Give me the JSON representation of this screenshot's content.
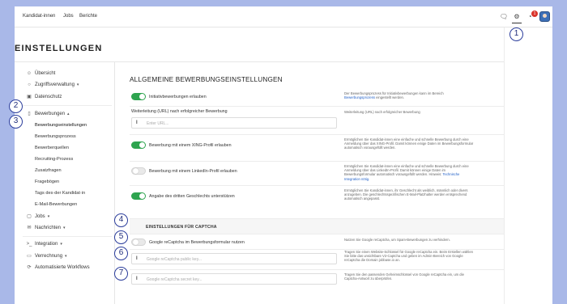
{
  "topnav": {
    "items": [
      "Kandidat-innen",
      "Jobs",
      "Berichte"
    ],
    "notification_count": "1"
  },
  "page_title": "EINSTELLUNGEN",
  "sidebar": {
    "overview": "Übersicht",
    "access": "Zugriffsverwaltung",
    "privacy": "Datenschutz",
    "applications": "Bewerbungen",
    "sub_items": [
      "Bewerbungseinstellungen",
      "Bewerbungsprozess",
      "Bewerberquellen",
      "Recruiting-Prozess",
      "Zusatzfragen",
      "Fragebögen",
      "Tags des·der Kandidat·in",
      "E-Mail-Bewerbungen"
    ],
    "jobs": "Jobs",
    "messages": "Nachrichten",
    "integration": "Integration",
    "billing": "Verrechnung",
    "workflows": "Automatisierte Workflows"
  },
  "main": {
    "title": "ALLGEMEINE BEWERBUNGSEINSTELLUNGEN",
    "options": [
      {
        "label": "Initiativbewerbungen erlauben",
        "on": true,
        "help": "Der Bewerbungsprozess für Initiativbewerbungen kann im Bereich",
        "help_link": "Bewerbungsprozess",
        "help_tail": "eingestellt werden."
      },
      {
        "label": "Bewerbung mit einem XING-Profil erlauben",
        "on": true,
        "help": "Ermöglichen Sie Kandidat-innen eine einfache und schnelle Bewerbung durch eine Anmeldung über das XING-Profil. Damit können einige Daten im Bewerbungsformular automatisch vorausgefüllt werden."
      },
      {
        "label": "Bewerbung mit einem LinkedIn-Profil erlauben",
        "on": false,
        "help": "Ermöglichen Sie Kandidat-innen eine einfache und schnelle Bewerbung durch eine Anmeldung über das LinkedIn-Profil. Damit können einige Daten im Bewerbungsformular automatisch vorausgefüllt werden. Hinweis:",
        "help_link": "Technische Integration nötig."
      },
      {
        "label": "Angabe des dritten Geschlechts unterstützen",
        "on": true,
        "help": "Ermöglichen Sie Kandidat-innen, ihr Geschlecht als weiblich, männlich oder divers anzugeben. Die geschlechtsspezifischen E-Mail-Platzhalter werden entsprechend automatisch angepasst."
      }
    ],
    "redirect": {
      "label": "Weiterleitung (URL) nach erfolgreicher Bewerbung",
      "placeholder": "Enter URL...",
      "help": "Weiterleitung (URL) nach erfolgreicher Bewerbung"
    },
    "captcha_section": "EINSTELLUNGEN FÜR CAPTCHA",
    "captcha": {
      "toggle_label": "Google reCaptcha im Bewerbungsformular nutzen",
      "toggle_on": false,
      "toggle_help": "Nutzen Sie Google reCaptcha, um Spam-Bewerbungen zu verhindern.",
      "public_key_placeholder": "Google reCaptcha public key...",
      "public_key_help": "Tragen Sie einen Website-Schlüssel für Google reCaptcha ein. Beim Erstellen wählen Sie bitte das unsichtbare V2-Captcha und geben im Admin-Bereich von Google reCaptcha die Domain jobbase.io an.",
      "secret_key_placeholder": "Google reCaptcha secret key...",
      "secret_key_help": "Tragen Sie den passenden Geheimschlüssel von Google reCaptcha ein, um die Captcha-Antwort zu überprüfen."
    }
  },
  "callouts": [
    "1",
    "2",
    "3",
    "4",
    "5",
    "6",
    "7"
  ],
  "colors": {
    "toggle_on": "#2ea44f",
    "callout": "#2b3d9c",
    "link": "#2563c9",
    "badge": "#d9342b"
  }
}
